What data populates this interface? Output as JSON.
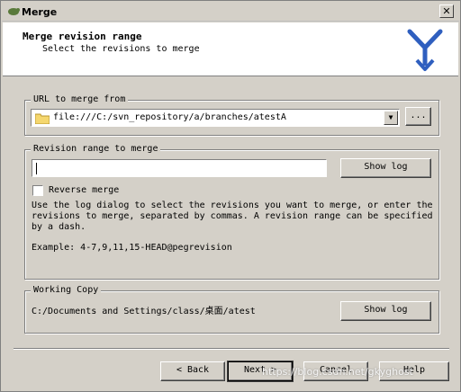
{
  "window": {
    "title": "Merge",
    "close_glyph": "✕"
  },
  "header": {
    "title": "Merge revision range",
    "subtitle": "Select the revisions to merge",
    "logo_icon": "tortoisesvn-merge-icon"
  },
  "url_group": {
    "label": "URL to merge from",
    "url_value": "file:///C:/svn_repository/a/branches/atestA",
    "browse_label": "..."
  },
  "revision_group": {
    "label": "Revision range to merge",
    "range_value": "",
    "show_log_label": "Show log",
    "reverse_label": "Reverse merge",
    "reverse_checked": false,
    "help_text": "Use the log dialog to select the revisions you want to merge, or enter the revisions to merge, separated by commas. A revision range can be specified by a dash.",
    "example": "Example: 4-7,9,11,15-HEAD@pegrevision"
  },
  "working_copy": {
    "label": "Working Copy",
    "path": "C:/Documents and Settings/class/桌面/atest",
    "show_log_label": "Show log"
  },
  "footer": {
    "back_label": "< Back",
    "next_label": "Next >",
    "cancel_label": "Cancel",
    "help_label": "Help"
  },
  "watermark": "https://blog.csdn.net/gkyghost",
  "colors": {
    "dialog_bg": "#d4d0c8",
    "header_bg": "#ffffff",
    "logo_blue": "#2f5fbf"
  }
}
